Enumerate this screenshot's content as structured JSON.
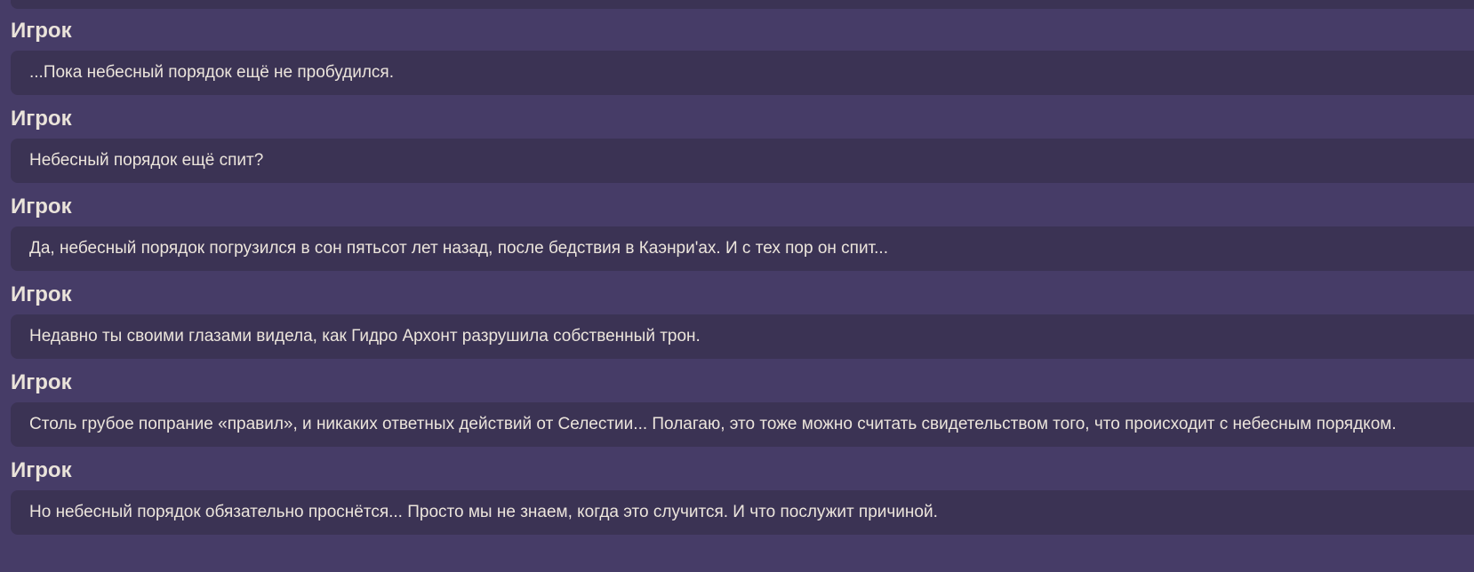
{
  "dialogue": [
    {
      "speaker": "Игрок",
      "text": "...Пока небесный порядок ещё не пробудился."
    },
    {
      "speaker": "Игрок",
      "text": "Небесный порядок ещё спит?"
    },
    {
      "speaker": "Игрок",
      "text": "Да, небесный порядок погрузился в сон пятьсот лет назад, после бедствия в Каэнри'ах. И с тех пор он спит..."
    },
    {
      "speaker": "Игрок",
      "text": "Недавно ты своими глазами видела, как Гидро Архонт разрушила собственный трон."
    },
    {
      "speaker": "Игрок",
      "text": "Столь грубое попрание «правил», и никаких ответных действий от Селестии... Полагаю, это тоже можно считать свидетельством того, что происходит с небесным порядком."
    },
    {
      "speaker": "Игрок",
      "text": "Но небесный порядок обязательно проснётся... Просто мы не знаем, когда это случится. И что послужит причиной."
    }
  ],
  "colors": {
    "background": "#463c67",
    "bubble": "#3b3354",
    "text": "#ece5dc"
  }
}
